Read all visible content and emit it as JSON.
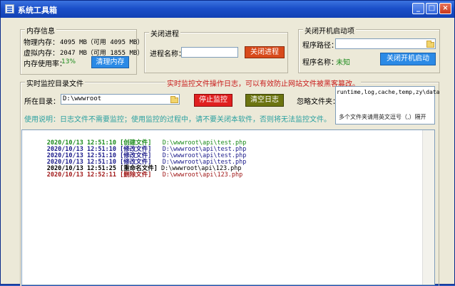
{
  "window": {
    "title": "系统工具箱"
  },
  "memory": {
    "legend": "内存信息",
    "physical_label": "物理内存：",
    "physical_value": "4095 MB（可用 4095 MB）",
    "virtual_label": "虚拟内存：",
    "virtual_value": "2047 MB（可用 1855 MB）",
    "usage_label": "内存使用率：",
    "usage_value": "13%",
    "clean_button": "清理内存"
  },
  "process": {
    "legend": "关闭进程",
    "name_label": "进程名称：",
    "name_value": "",
    "close_button": "关闭进程"
  },
  "startup": {
    "legend": "关闭开机启动项",
    "path_label": "程序路径：",
    "path_value": "",
    "name_label": "程序名称：",
    "name_value": "未知",
    "close_button": "关闭开机启动"
  },
  "monitor": {
    "legend": "实时监控目录文件",
    "log_title": "实时监控文件操作日志，可以有效防止网站文件被黑客篡改。",
    "dir_label": "所在目录：",
    "dir_value": "D:\\wwwroot",
    "stop_button": "停止监控",
    "clear_button": "清空日志",
    "ignore_label": "忽略文件夹：",
    "ignore_value": "runtime,log,cache,temp,zy\\data",
    "ignore_hint": "多个文件夹请用英文逗号（,）隔开",
    "usage_note": "使用说明：日志文件不需要监控；使用监控的过程中，请不要关闭本软件，否则将无法监控文件。",
    "log": [
      {
        "time": "2020/10/13 12:51:10",
        "action": "[创建文件]",
        "path": "D:\\wwwroot\\api\\test.php",
        "color": "#1a8a1a"
      },
      {
        "time": "2020/10/13 12:51:10",
        "action": "[修改文件]",
        "path": "D:\\wwwroot\\api\\test.php",
        "color": "#1a1a8a"
      },
      {
        "time": "2020/10/13 12:51:10",
        "action": "[修改文件]",
        "path": "D:\\wwwroot\\api\\test.php",
        "color": "#1a1a8a"
      },
      {
        "time": "2020/10/13 12:51:10",
        "action": "[修改文件]",
        "path": "D:\\wwwroot\\api\\test.php",
        "color": "#1a1a8a"
      },
      {
        "time": "2020/10/13 12:51:25",
        "action": "[重命名文件]",
        "path": "D:\\wwwroot\\api\\123.php",
        "color": "#000000"
      },
      {
        "time": "2020/10/13 12:52:11",
        "action": "[删除文件]",
        "path": "D:\\wwwroot\\api\\123.php",
        "color": "#a01818"
      }
    ]
  },
  "colors": {
    "red_button": "#e02020",
    "orange_button": "#d84a1b",
    "blue_button": "#2b8ae6",
    "olive_button": "#6c7410"
  }
}
